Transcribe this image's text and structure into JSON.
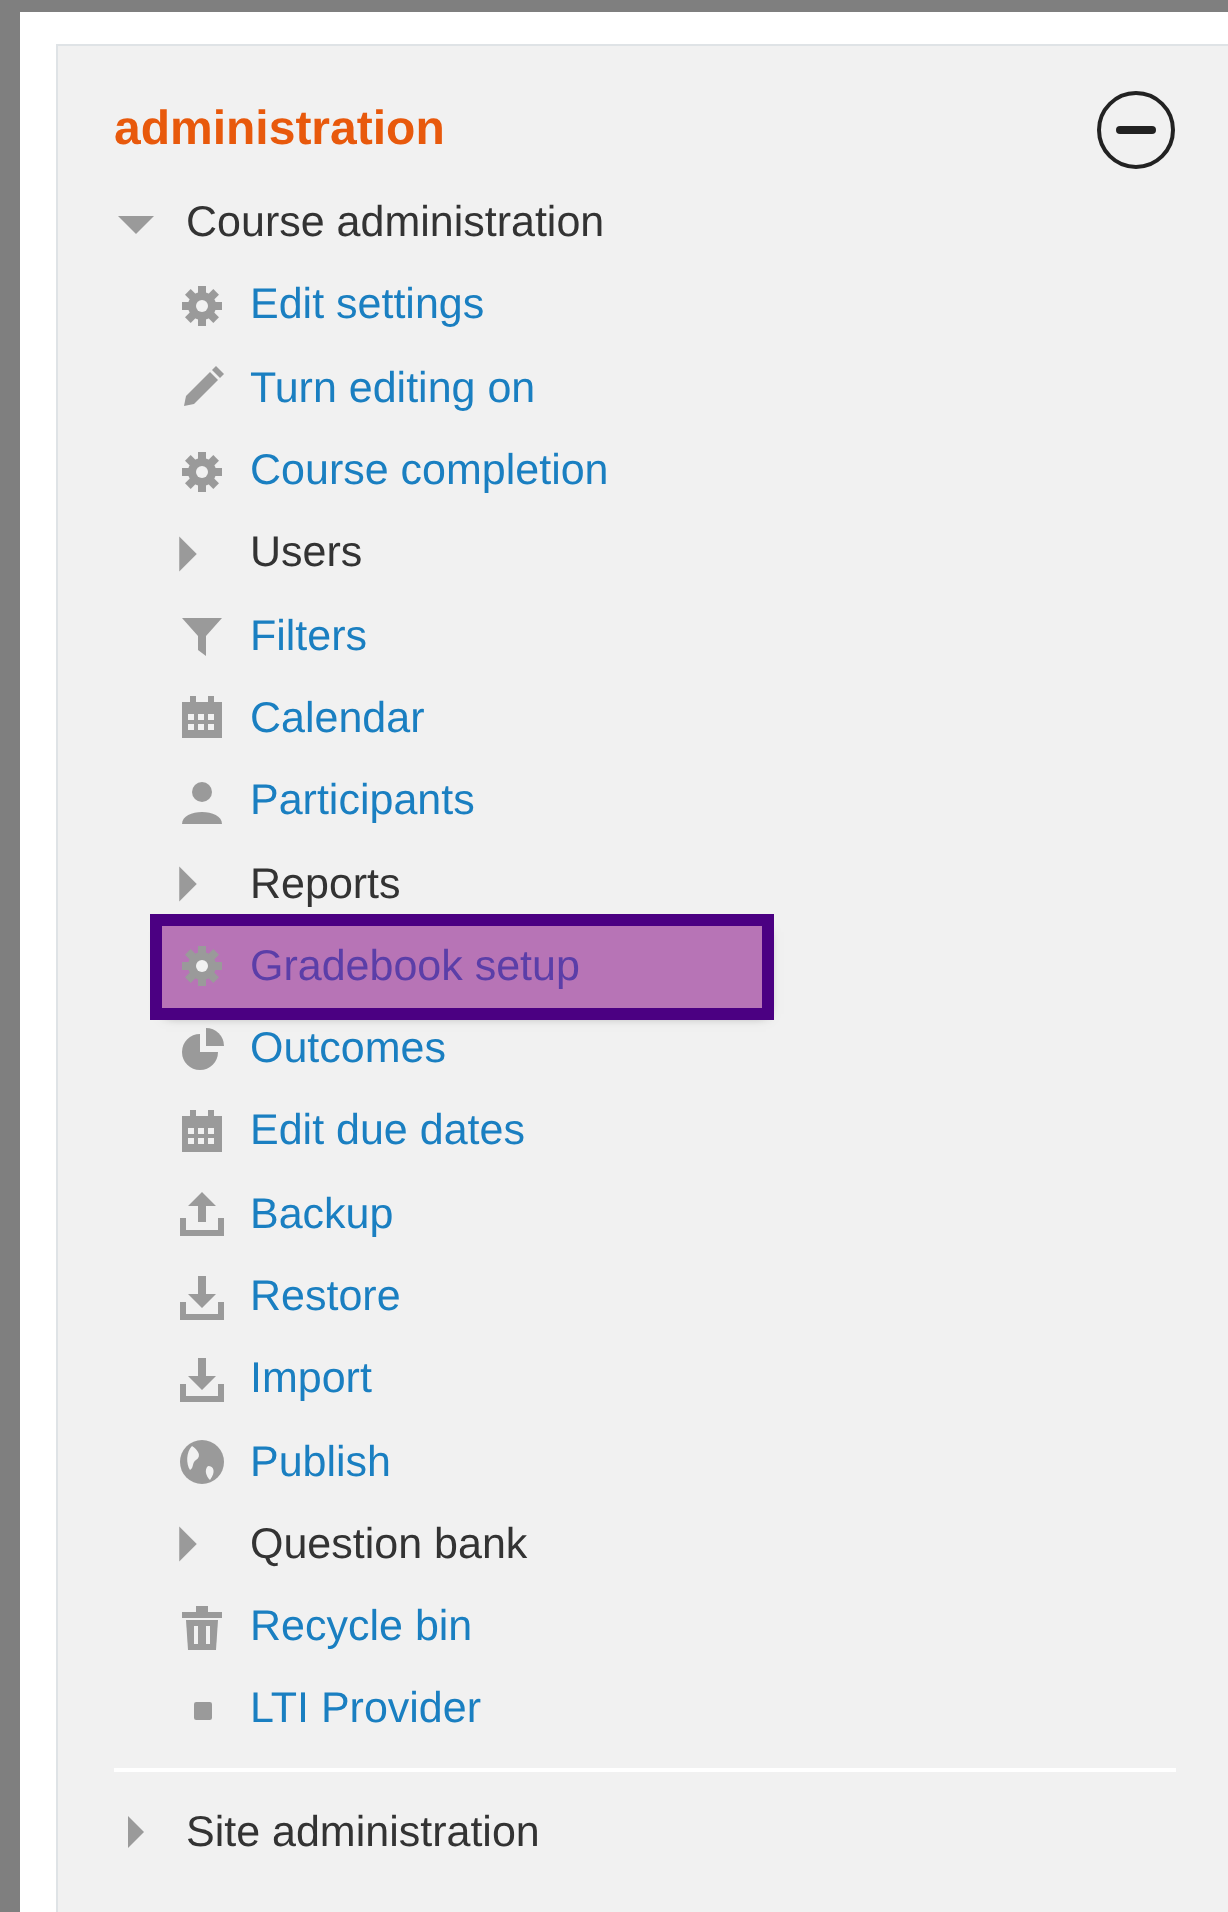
{
  "block": {
    "title": "administration"
  },
  "tree": [
    {
      "label": "Course administration",
      "expanded": true,
      "children": [
        {
          "label": "Edit settings",
          "kind": "gear",
          "highlighted": false
        },
        {
          "label": "Turn editing on",
          "kind": "pencil",
          "highlighted": false
        },
        {
          "label": "Course completion",
          "kind": "gear",
          "highlighted": false
        },
        {
          "label": "Users",
          "kind": "branch",
          "expanded": false
        },
        {
          "label": "Filters",
          "kind": "filter",
          "highlighted": false
        },
        {
          "label": "Calendar",
          "kind": "calendar",
          "highlighted": false
        },
        {
          "label": "Participants",
          "kind": "person",
          "highlighted": false
        },
        {
          "label": "Reports",
          "kind": "branch",
          "expanded": false
        },
        {
          "label": "Gradebook setup",
          "kind": "gear",
          "highlighted": true
        },
        {
          "label": "Outcomes",
          "kind": "pie",
          "highlighted": false
        },
        {
          "label": "Edit due dates",
          "kind": "calendar",
          "highlighted": false
        },
        {
          "label": "Backup",
          "kind": "upload",
          "highlighted": false
        },
        {
          "label": "Restore",
          "kind": "download",
          "highlighted": false
        },
        {
          "label": "Import",
          "kind": "download",
          "highlighted": false
        },
        {
          "label": "Publish",
          "kind": "globe",
          "highlighted": false
        },
        {
          "label": "Question bank",
          "kind": "branch",
          "expanded": false
        },
        {
          "label": "Recycle bin",
          "kind": "trash",
          "highlighted": false
        },
        {
          "label": "LTI Provider",
          "kind": "square",
          "highlighted": false
        }
      ]
    },
    {
      "label": "Site administration",
      "expanded": false
    }
  ]
}
